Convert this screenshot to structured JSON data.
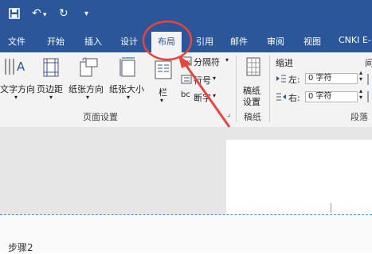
{
  "quick_access": {
    "save_icon": "save-icon",
    "undo_symbol": "↶",
    "redo_symbol": "↻",
    "customize_symbol": "▾"
  },
  "tabs": [
    {
      "label": "文件"
    },
    {
      "label": "开始"
    },
    {
      "label": "插入"
    },
    {
      "label": "设计"
    },
    {
      "label": "布局"
    },
    {
      "label": "引用"
    },
    {
      "label": "邮件"
    },
    {
      "label": "审阅"
    },
    {
      "label": "视图"
    },
    {
      "label": "CNKI E-"
    }
  ],
  "ribbon": {
    "page_setup": {
      "text_direction": "文字方向",
      "margins": "页边距",
      "orientation": "纸张方向",
      "size": "纸张大小",
      "columns": "栏",
      "breaks": "分隔符",
      "line_numbers": "行号",
      "hyphenation": "断字",
      "group_label": "页面设置",
      "launcher_symbol": "⌟"
    },
    "manuscript": {
      "button_line1": "稿纸",
      "button_line2": "设置",
      "group_label": "稿纸"
    },
    "paragraph": {
      "indent_title": "缩进",
      "spacing_title_fragment": "间",
      "left_label": "左:",
      "left_value": "0 字符",
      "right_label": "右:",
      "right_value": "0 字符",
      "group_label": "段落"
    }
  },
  "document": {
    "caption": "步骤2"
  },
  "annotation": {
    "color": "#e8453c"
  },
  "colors": {
    "accent": "#2b579a",
    "ribbon_bg": "#f3f3f3"
  }
}
